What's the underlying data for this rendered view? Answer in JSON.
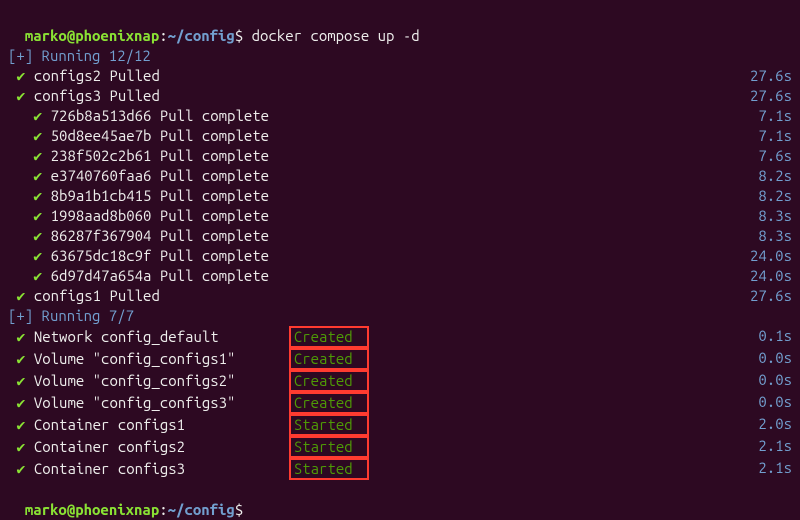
{
  "prompt": {
    "user": "marko@phoenixnap",
    "colon": ":",
    "path": "~/config",
    "dollar": "$"
  },
  "command": "docker compose up -d",
  "headers": {
    "pull": "[+] Running 12/12",
    "up": "[+] Running 7/7"
  },
  "pulls": [
    {
      "indent": " ",
      "name": "configs2 Pulled",
      "time": "27.6s"
    },
    {
      "indent": " ",
      "name": "configs3 Pulled",
      "time": "27.6s"
    },
    {
      "indent": "   ",
      "name": "726b8a513d66 Pull complete",
      "time": "7.1s"
    },
    {
      "indent": "   ",
      "name": "50d8ee45ae7b Pull complete",
      "time": "7.1s"
    },
    {
      "indent": "   ",
      "name": "238f502c2b61 Pull complete",
      "time": "7.6s"
    },
    {
      "indent": "   ",
      "name": "e3740760faa6 Pull complete",
      "time": "8.2s"
    },
    {
      "indent": "   ",
      "name": "8b9a1b1cb415 Pull complete",
      "time": "8.2s"
    },
    {
      "indent": "   ",
      "name": "1998aad8b060 Pull complete",
      "time": "8.3s"
    },
    {
      "indent": "   ",
      "name": "86287f367904 Pull complete",
      "time": "8.3s"
    },
    {
      "indent": "   ",
      "name": "63675dc18c9f Pull complete",
      "time": "24.0s"
    },
    {
      "indent": "   ",
      "name": "6d97d47a654a Pull complete",
      "time": "24.0s"
    },
    {
      "indent": " ",
      "name": "configs1 Pulled",
      "time": "27.6s"
    }
  ],
  "resources": [
    {
      "name": "Network config_default",
      "status": "Created",
      "time": "0.1s"
    },
    {
      "name": "Volume \"config_configs1\"",
      "status": "Created",
      "time": "0.0s"
    },
    {
      "name": "Volume \"config_configs2\"",
      "status": "Created",
      "time": "0.0s"
    },
    {
      "name": "Volume \"config_configs3\"",
      "status": "Created",
      "time": "0.0s"
    },
    {
      "name": "Container configs1",
      "status": "Started",
      "time": "2.0s"
    },
    {
      "name": "Container configs2",
      "status": "Started",
      "time": "2.1s"
    },
    {
      "name": "Container configs3",
      "status": "Started",
      "time": "2.1s"
    }
  ]
}
